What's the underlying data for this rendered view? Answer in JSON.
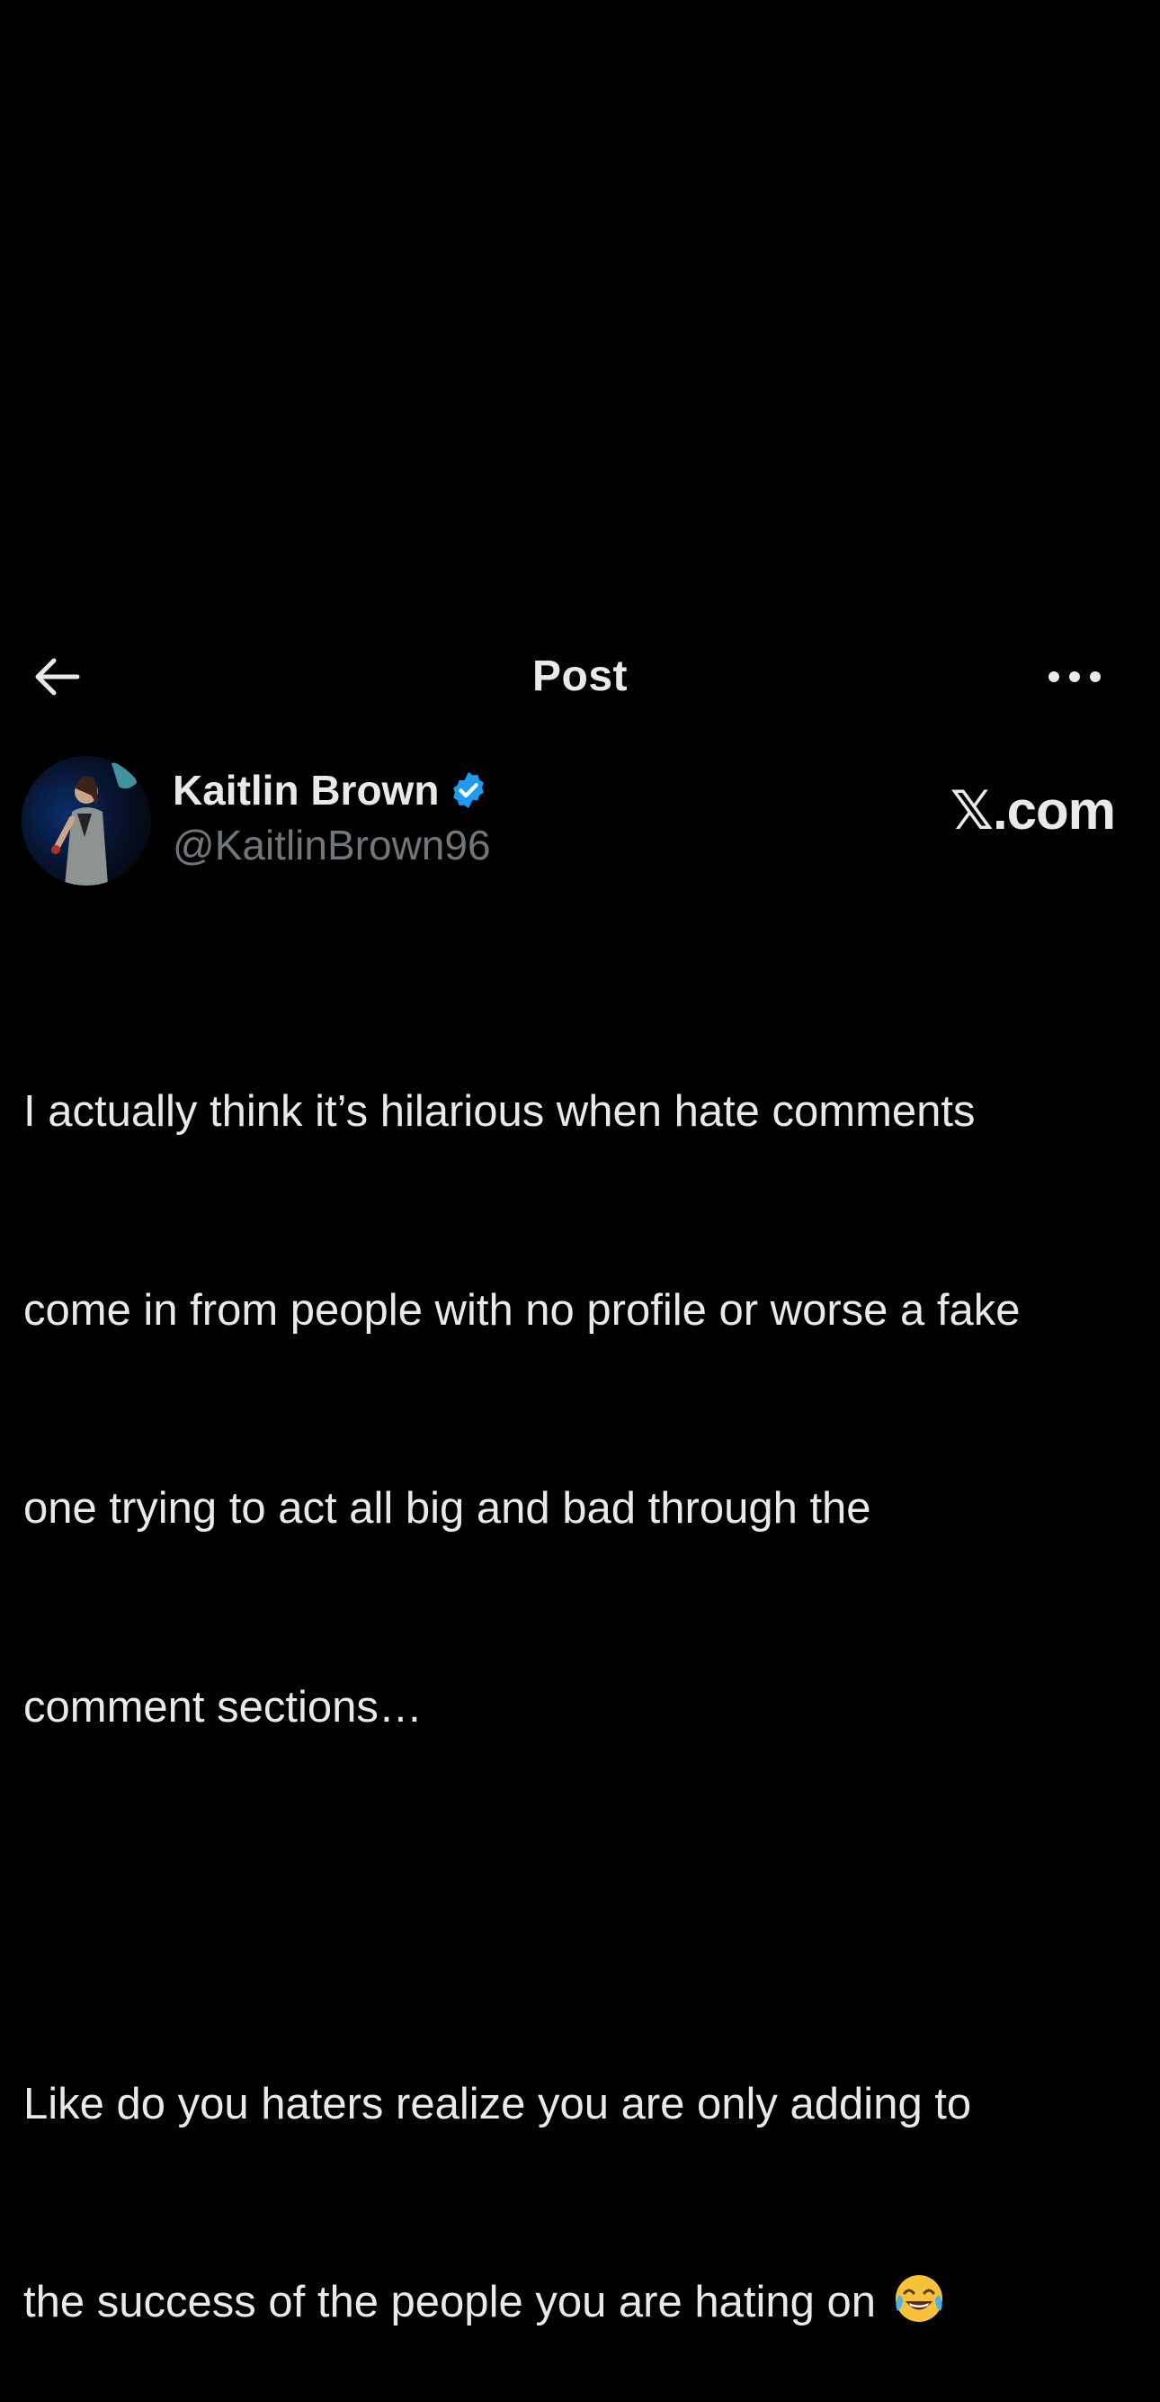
{
  "header": {
    "title": "Post",
    "back_icon": "arrow-left-icon",
    "more_icon": "more-horizontal-icon"
  },
  "author": {
    "display_name": "Kaitlin Brown",
    "handle": "@KaitlinBrown96",
    "verified_icon": "verified-badge-icon",
    "verified_color": "#1d9bf0"
  },
  "watermark": "𝕏.com",
  "post": {
    "paragraph_1_line_1": "I actually think it’s hilarious when hate comments",
    "paragraph_1_line_2": "come in from people with no profile or worse a fake",
    "paragraph_1_line_3": "one trying to act all big and bad through the",
    "paragraph_1_line_4": "comment sections…",
    "paragraph_2_line_1": "Like do you haters realize you are only adding to",
    "paragraph_2_line_2": "the success of the people you are hating on",
    "emoji_icon": "face-with-tears-of-joy-icon"
  },
  "colors": {
    "background": "#000000",
    "primary_text": "#e7e9ea",
    "secondary_text": "#71767b"
  }
}
